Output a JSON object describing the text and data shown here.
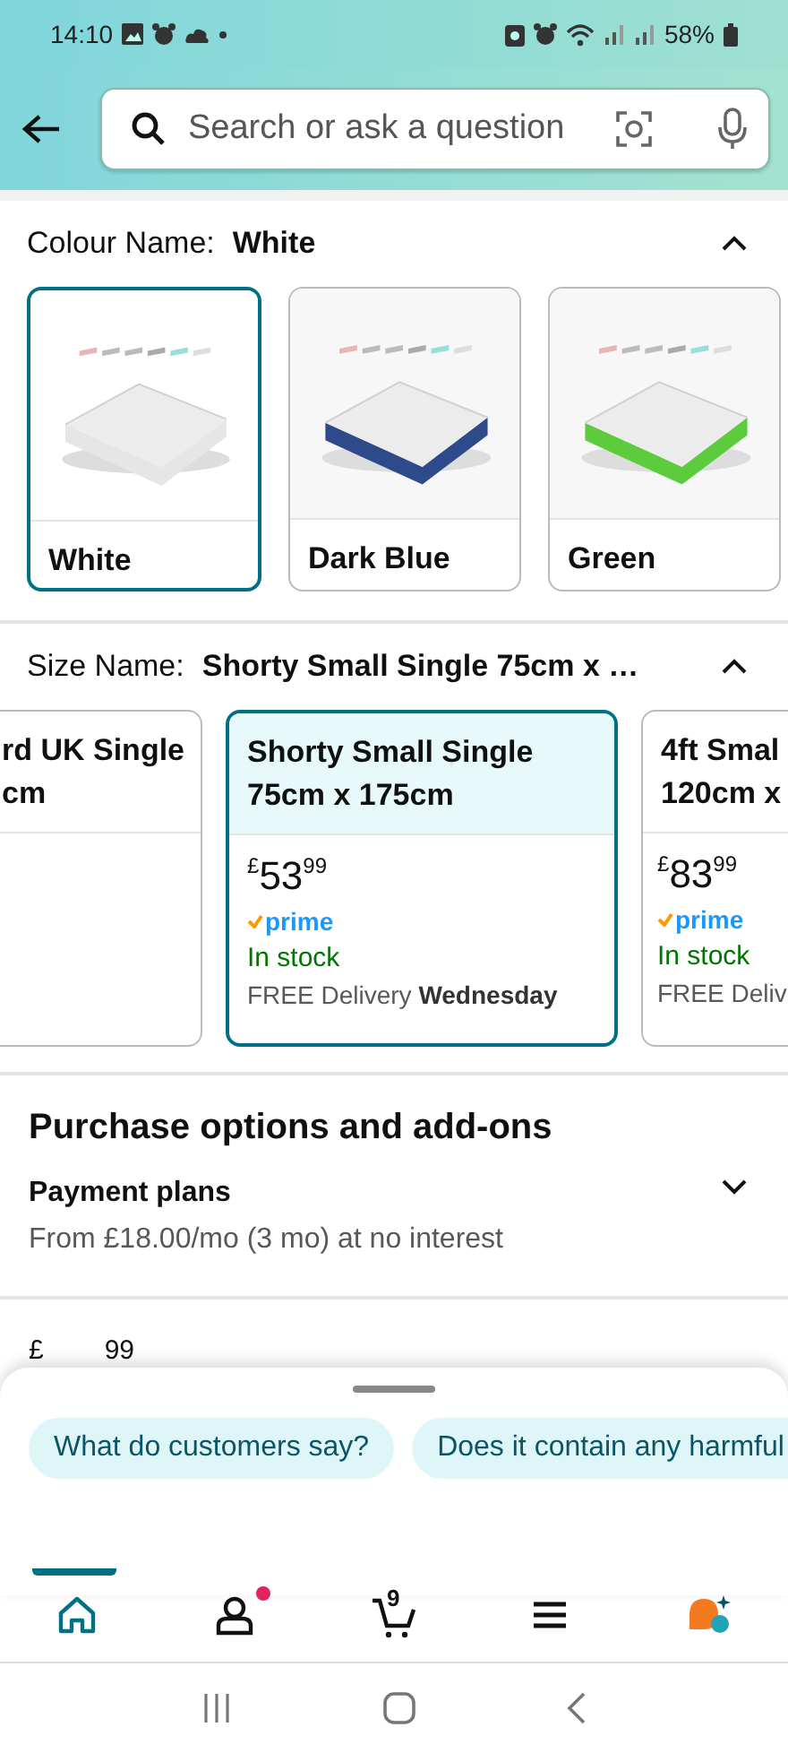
{
  "status_bar": {
    "time": "14:10",
    "battery": "58%"
  },
  "search": {
    "placeholder": "Search or ask a question"
  },
  "colour": {
    "label": "Colour Name:",
    "value": "White",
    "expanded": true,
    "options": [
      {
        "name": "White",
        "selected": true,
        "color": "#e6e6e6"
      },
      {
        "name": "Dark Blue",
        "selected": false,
        "color": "#2f4a8a"
      },
      {
        "name": "Green",
        "selected": false,
        "color": "#5ccb3c"
      }
    ]
  },
  "size": {
    "label": "Size Name:",
    "value": "Shorty Small Single 75cm x …",
    "expanded": true,
    "options": [
      {
        "lines": [
          "rd UK Single",
          "cm"
        ],
        "selected": false
      },
      {
        "lines": [
          "Shorty Small Single",
          "75cm x 175cm"
        ],
        "selected": true,
        "price": {
          "currency": "£",
          "whole": "53",
          "fraction": "99"
        },
        "prime": "prime",
        "stock": "In stock",
        "delivery": "FREE Delivery **Wednesday**"
      },
      {
        "lines": [
          "4ft Smal",
          "120cm x"
        ],
        "selected": false,
        "price": {
          "currency": "£",
          "whole": "83",
          "fraction": "99"
        },
        "prime": "prime",
        "stock": "In stock",
        "delivery": "FREE Deliv"
      }
    ]
  },
  "purchase": {
    "title": "Purchase options and add-ons",
    "items": [
      {
        "title": "Payment plans",
        "detail": "From £18.00/mo (3 mo) at no interest",
        "expanded": false
      }
    ]
  },
  "price_peek": {
    "currency": "£",
    "fraction": "99"
  },
  "chips": [
    "What do customers say?",
    "Does it contain any harmful"
  ],
  "nav": [
    {
      "kind": "home",
      "selected": true
    },
    {
      "kind": "account",
      "selected": false,
      "badge": true
    },
    {
      "kind": "cart",
      "selected": false,
      "count": "9"
    },
    {
      "kind": "menu",
      "selected": false
    },
    {
      "kind": "assistant",
      "selected": false
    }
  ]
}
